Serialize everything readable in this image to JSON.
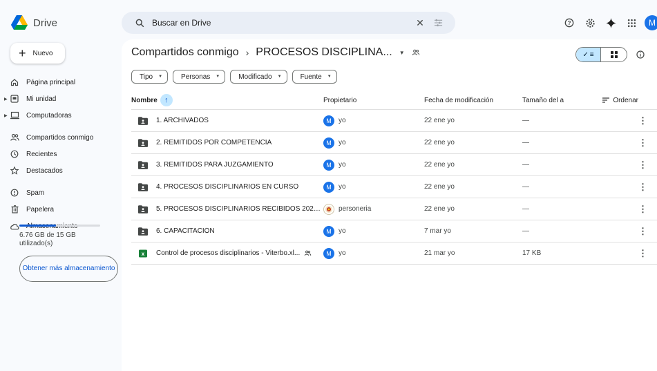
{
  "app": {
    "name": "Drive",
    "avatar_initial": "M"
  },
  "search": {
    "placeholder": "Buscar en Drive"
  },
  "top_icons": [
    "help-icon",
    "settings-icon",
    "gemini-icon",
    "apps-grid-icon"
  ],
  "sidebar": {
    "new_label": "Nuevo",
    "items": [
      {
        "label": "Página principal",
        "icon": "home-icon"
      },
      {
        "label": "Mi unidad",
        "icon": "drive-icon"
      },
      {
        "label": "Computadoras",
        "icon": "computer-icon"
      },
      {
        "label": "Compartidos conmigo",
        "icon": "people-icon"
      },
      {
        "label": "Recientes",
        "icon": "clock-icon"
      },
      {
        "label": "Destacados",
        "icon": "star-icon"
      },
      {
        "label": "Spam",
        "icon": "spam-icon"
      },
      {
        "label": "Papelera",
        "icon": "trash-icon"
      },
      {
        "label": "Almacenamiento",
        "icon": "cloud-icon"
      }
    ],
    "storage": {
      "text": "6.76 GB de 15 GB utilizado(s)",
      "used_fraction": 0.45
    },
    "more_storage_label": "Obtener más almacenamiento"
  },
  "breadcrumb": {
    "parent": "Compartidos conmigo",
    "current": "PROCESOS DISCIPLINA..."
  },
  "filters": [
    "Tipo",
    "Personas",
    "Modificado",
    "Fuente"
  ],
  "table": {
    "headers": {
      "name": "Nombre",
      "owner": "Propietario",
      "modified": "Fecha de modificación",
      "size": "Tamaño del a",
      "sort": "Ordenar"
    },
    "rows": [
      {
        "name": "1. ARCHIVADOS",
        "type": "shared-folder",
        "owner": "yo",
        "owner_avatar": "M",
        "modified": "22 ene yo",
        "size": "—"
      },
      {
        "name": "2. REMITIDOS POR COMPETENCIA",
        "type": "shared-folder",
        "owner": "yo",
        "owner_avatar": "M",
        "modified": "22 ene yo",
        "size": "—"
      },
      {
        "name": "3. REMITIDOS PARA JUZGAMIENTO",
        "type": "shared-folder",
        "owner": "yo",
        "owner_avatar": "M",
        "modified": "22 ene yo",
        "size": "—"
      },
      {
        "name": "4. PROCESOS DISCIPLINARIOS EN CURSO",
        "type": "shared-folder",
        "owner": "yo",
        "owner_avatar": "M",
        "modified": "22 ene yo",
        "size": "—"
      },
      {
        "name": "5. PROCESOS DISCIPLINARIOS RECIBIDOS 2025-...",
        "type": "shared-folder",
        "owner": "personeria",
        "owner_avatar": "",
        "modified": "22 ene yo",
        "size": "—"
      },
      {
        "name": "6. CAPACITACIÓN",
        "type": "shared-folder",
        "owner": "yo",
        "owner_avatar": "M",
        "modified": "7 mar yo",
        "size": "—"
      },
      {
        "name": "Control de procesos disciplinarios - Viterbo.xl...",
        "type": "excel-file",
        "shared": true,
        "owner": "yo",
        "owner_avatar": "M",
        "modified": "21 mar yo",
        "size": "17 KB"
      }
    ]
  },
  "colors": {
    "accent": "#0b57d0",
    "selected_toggle": "#c2e7ff",
    "avatar": "#1a73e8",
    "excel": "#188038",
    "background": "#f8fafd"
  }
}
